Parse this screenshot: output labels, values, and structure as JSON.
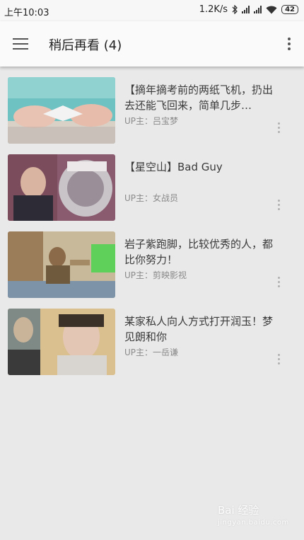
{
  "status_bar": {
    "time": "上午10:03",
    "network_speed": "1.2K/s",
    "battery": "42"
  },
  "header": {
    "title": "稍后再看 (4)"
  },
  "videos": [
    {
      "title": "【摘年摘考前的两纸飞机，扔出去还能飞回来，简单几步…",
      "uploader": "UP主：吕宝梦"
    },
    {
      "title": "【星空山】Bad Guy",
      "uploader": "UP主：女战员"
    },
    {
      "title": "岩子紫跑脚，比较优秀的人，都比你努力！",
      "uploader": "UP主：剪映影视"
    },
    {
      "title": "某家私人向人方式打开润玉！梦见朗和你",
      "uploader": "UP主：一岳谦"
    }
  ],
  "watermark": {
    "text": "Bai 经验",
    "sub": "jingyan.baidu.com"
  }
}
